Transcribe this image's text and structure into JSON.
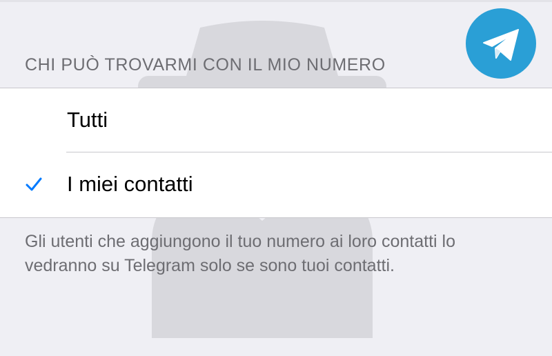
{
  "section_header": "CHI PUÒ TROVARMI CON IL MIO NUMERO",
  "options": [
    {
      "label": "Tutti",
      "selected": false
    },
    {
      "label": "I miei contatti",
      "selected": true
    }
  ],
  "footer_note": "Gli utenti che aggiungono il tuo numero ai loro contatti lo vedranno su Telegram solo se sono tuoi contatti.",
  "icons": {
    "check": "checkmark-icon",
    "logo": "telegram-logo-icon",
    "watermark": "incognito-icon"
  },
  "colors": {
    "accent": "#007aff",
    "badge": "#2a9fd6",
    "background": "#efeff4",
    "secondary_text": "#6d6d72"
  }
}
